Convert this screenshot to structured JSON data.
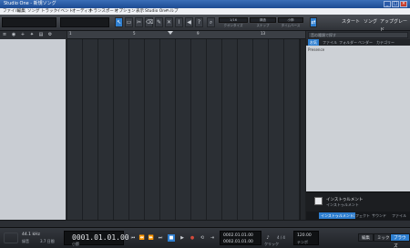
{
  "window": {
    "title": "Studio One - 新規ソング",
    "controls": [
      "_",
      "□",
      "×"
    ]
  },
  "menu": [
    "ファイル",
    "編集",
    "ソング",
    "トラック",
    "イベント",
    "オーディオ",
    "トランスポート",
    "オプション",
    "表示",
    "Studio One",
    "ヘルプ"
  ],
  "toolbar": {
    "tools": [
      "arrow",
      "range",
      "split",
      "eraser",
      "pencil",
      "mute",
      "bend",
      "listen"
    ],
    "help_label": "?",
    "modes": [
      {
        "label": "1/16",
        "caption": "クオンタイズ"
      },
      {
        "label": "構造",
        "caption": "スナップ"
      },
      {
        "label": "小節",
        "caption": "タイムベース"
      }
    ],
    "nav": [
      "スタート",
      "ソング",
      "アップグレード"
    ]
  },
  "ruler": {
    "marks": [
      "1",
      "5",
      "9",
      "13"
    ]
  },
  "browser": {
    "search_placeholder": "音の種類で探す",
    "tabs": [
      "ファイル",
      "フォルダー",
      "ベンダー",
      "カテゴリー"
    ],
    "selected_tab_label": "お気",
    "items": [
      "Presence"
    ],
    "info_title": "インストゥルメント",
    "info_subtitle": "インストゥルメント",
    "bottom_tabs": [
      "インストゥルメント",
      "エフェクト",
      "サウンド",
      "ファイル"
    ]
  },
  "transport": {
    "sample_rate": "44.1 kHz",
    "rec_label": "録音",
    "time_label": "3.7 日間",
    "position": "0001.01.01.00",
    "position_unit": "小節",
    "loop_start": "0002.01.01.00",
    "loop_end": "0002.01.01.00",
    "tempo": "120.00",
    "tempo_label": "テンポ",
    "signature": "4 / 4",
    "metronome_label": "クリック",
    "views": [
      "編集",
      "ミックス",
      "ブラウズ"
    ]
  }
}
